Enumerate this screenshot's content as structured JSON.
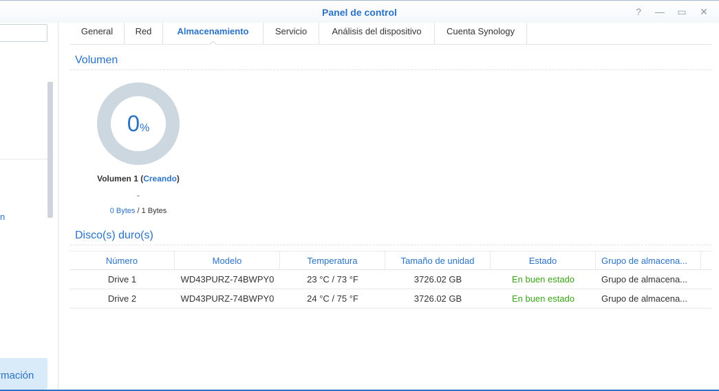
{
  "window": {
    "title": "Panel de control",
    "buttons": {
      "help": "?",
      "minimize": "—",
      "maximize": "▭",
      "close": "✕"
    }
  },
  "sidebar": {
    "search_placeholder": "",
    "partial_item": "n",
    "active_item_label": "rmación"
  },
  "tabs": [
    {
      "label": "General"
    },
    {
      "label": "Red"
    },
    {
      "label": "Almacenamiento"
    },
    {
      "label": "Servicio"
    },
    {
      "label": "Análisis del dispositivo"
    },
    {
      "label": "Cuenta Synology"
    }
  ],
  "active_tab": "Almacenamiento",
  "volume_section": {
    "title": "Volumen",
    "usage_percent_value": "0",
    "usage_percent_sign": "%",
    "volume_name": "Volumen 1",
    "status_open": " (",
    "status": "Creando",
    "status_close": ")",
    "dash": "-",
    "used": "0 Bytes",
    "separator": " / ",
    "total": "1 Bytes"
  },
  "disks_section": {
    "title": "Disco(s) duro(s)",
    "columns": [
      "Número",
      "Modelo",
      "Temperatura",
      "Tamaño de unidad",
      "Estado",
      "Grupo de almacena..."
    ],
    "rows": [
      [
        "Drive 1",
        "WD43PURZ-74BWPY0",
        "23 °C / 73 °F",
        "3726.02 GB",
        "En buen estado",
        "Grupo de almacena..."
      ],
      [
        "Drive 2",
        "WD43PURZ-74BWPY0",
        "24 °C / 75 °F",
        "3726.02 GB",
        "En buen estado",
        "Grupo de almacena..."
      ]
    ]
  },
  "colors": {
    "accent": "#2a72c4",
    "good": "#3aa418",
    "donut_track": "#cdd7df"
  }
}
